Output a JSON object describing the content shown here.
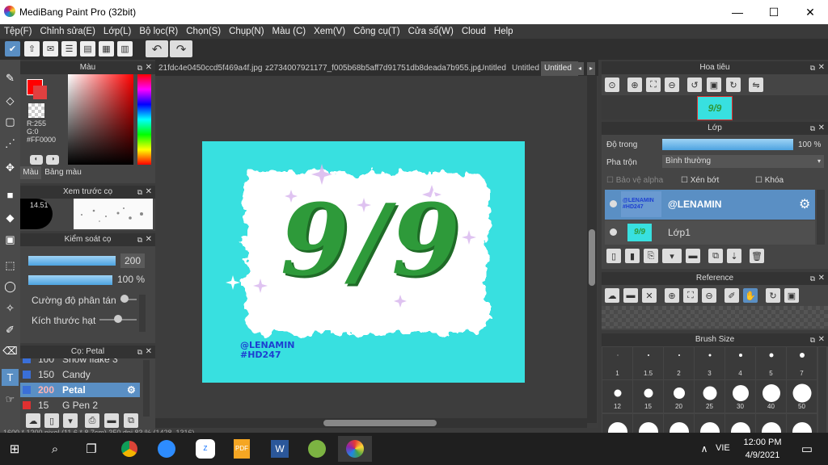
{
  "window": {
    "title": "MediBang Paint Pro (32bit)",
    "minimize": "—",
    "maximize": "☐",
    "close": "✕"
  },
  "menu": [
    "Tệp(F)",
    "Chỉnh sửa(E)",
    "Lớp(L)",
    "Bộ lọc(R)",
    "Chọn(S)",
    "Chụp(N)",
    "Màu (C)",
    "Xem(V)",
    "Công cụ(T)",
    "Cửa sổ(W)",
    "Cloud",
    "Help"
  ],
  "color_panel": {
    "title": "Màu",
    "r": "R:255",
    "g": "G:0",
    "hex": "#FF0000",
    "tab1": "Màu",
    "tab2": "Bảng màu",
    "primary": "#ff0000"
  },
  "brush_preview": {
    "title": "Xem trước cọ",
    "size": "14.51"
  },
  "brush_control": {
    "title": "Kiểm soát cọ",
    "size": "200",
    "opacity": "100 %",
    "scatter_label": "Cường độ phân tán",
    "particle_label": "Kích thước hạt"
  },
  "brush_list": {
    "title": "Cọ: Petal",
    "items": [
      {
        "size": "100",
        "name": "Snow flake 3",
        "color": "#3a6fd8"
      },
      {
        "size": "150",
        "name": "Candy",
        "color": "#3a6fd8"
      },
      {
        "size": "200",
        "name": "Petal",
        "color": "#3a6fd8"
      },
      {
        "size": "15",
        "name": "G Pen 2",
        "color": "#e03030"
      }
    ]
  },
  "tabs": [
    "21fdc4e0450ccd5f469a4f.jpg",
    "z2734007921177_f005b68b5aff7d91751db8deada7b955.jpg",
    "Untitled",
    "Untitled",
    "Untitled"
  ],
  "artwork": {
    "text": "9/9",
    "credit1": "@LENAMIN",
    "credit2": "#HD247"
  },
  "navigator": {
    "title": "Hoa tiêu",
    "thumb": "9/9"
  },
  "layers": {
    "title": "Lớp",
    "opacity_label": "Độ trong",
    "opacity_value": "100 %",
    "blend_label": "Pha trộn",
    "blend_value": "Bình thường",
    "protect_alpha": "Bảo vệ alpha",
    "clipping": "Xén bớt",
    "lock": "Khóa",
    "items": [
      {
        "name": "@LENAMIN",
        "thumb": "@LENAMIN #HD247"
      },
      {
        "name": "Lớp1",
        "thumb": "9/9"
      }
    ]
  },
  "reference": {
    "title": "Reference"
  },
  "brush_size": {
    "title": "Brush Size",
    "labels": [
      "1",
      "1.5",
      "2",
      "3",
      "4",
      "5",
      "7",
      "12",
      "15",
      "20",
      "25",
      "30",
      "40",
      "50"
    ]
  },
  "status": {
    "text": "1600 * 1200 pixel  (11.6 * 8.7cm)  350 dpi  83 %  (1428, 1316)"
  },
  "taskbar": {
    "lang": "VIE",
    "time": "12:00 PM",
    "date": "4/9/2021"
  }
}
